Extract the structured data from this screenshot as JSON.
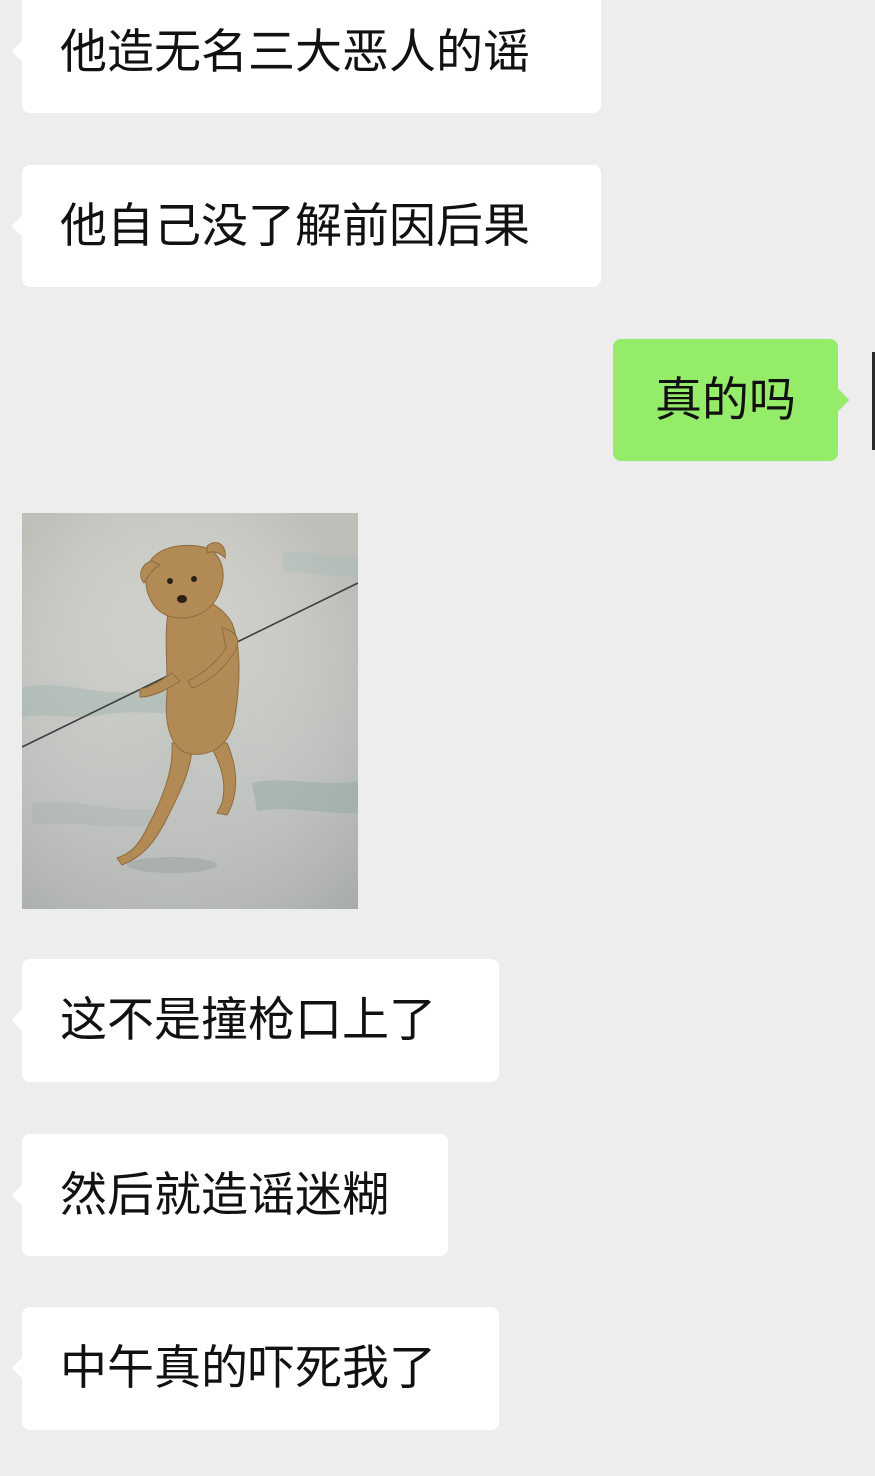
{
  "chat": {
    "messages": [
      {
        "side": "in",
        "text": "他造无名三大恶人的谣"
      },
      {
        "side": "in",
        "text": "他自己没了解前因后果"
      },
      {
        "side": "out",
        "text": "真的吗"
      },
      {
        "side": "in",
        "type": "image",
        "image_subject": "dog-standing-on-hind-legs"
      },
      {
        "side": "in",
        "text": "这不是撞枪口上了"
      },
      {
        "side": "in",
        "text": "然后就造谣迷糊"
      },
      {
        "side": "in",
        "text": "中午真的吓死我了"
      }
    ]
  },
  "colors": {
    "background": "#ededed",
    "incoming_bubble": "#ffffff",
    "outgoing_bubble": "#95ec69",
    "text": "#111111"
  }
}
